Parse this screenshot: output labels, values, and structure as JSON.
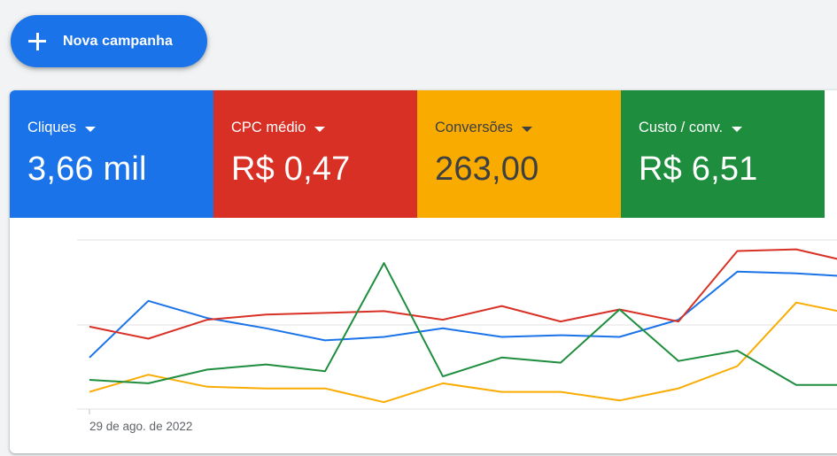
{
  "new_campaign": {
    "label": "Nova campanha",
    "icon": "plus-icon"
  },
  "metrics": [
    {
      "label": "Cliques",
      "value": "3,66 mil",
      "color": "#1a73e8",
      "text_color": "#ffffff"
    },
    {
      "label": "CPC médio",
      "value": "R$ 0,47",
      "color": "#d93025",
      "text_color": "#ffffff"
    },
    {
      "label": "Conversões",
      "value": "263,00",
      "color": "#f9ab00",
      "text_color": "#3c4043"
    },
    {
      "label": "Custo / conv.",
      "value": "R$ 6,51",
      "color": "#1e8e3e",
      "text_color": "#ffffff"
    }
  ],
  "chart_data": {
    "type": "line",
    "x_start_label": "29 de ago. de 2022",
    "grid": true,
    "legend": "metric tiles above chart",
    "ylim": [
      0,
      100
    ],
    "series": [
      {
        "name": "Cliques",
        "color": "#1a73e8",
        "values": [
          30,
          63,
          53,
          47,
          40,
          42,
          47,
          42,
          43,
          42,
          52,
          80,
          79,
          77
        ]
      },
      {
        "name": "CPC médio",
        "color": "#d93025",
        "values": [
          48,
          41,
          52,
          55,
          56,
          57,
          52,
          60,
          51,
          58,
          51,
          92,
          93,
          85
        ]
      },
      {
        "name": "Conversões",
        "color": "#f9ab00",
        "values": [
          10,
          20,
          13,
          12,
          12,
          4,
          15,
          10,
          10,
          5,
          12,
          25,
          62,
          55
        ]
      },
      {
        "name": "Custo / conv.",
        "color": "#1e8e3e",
        "values": [
          17,
          15,
          23,
          26,
          22,
          85,
          19,
          30,
          27,
          58,
          28,
          34,
          14,
          14
        ]
      }
    ]
  }
}
